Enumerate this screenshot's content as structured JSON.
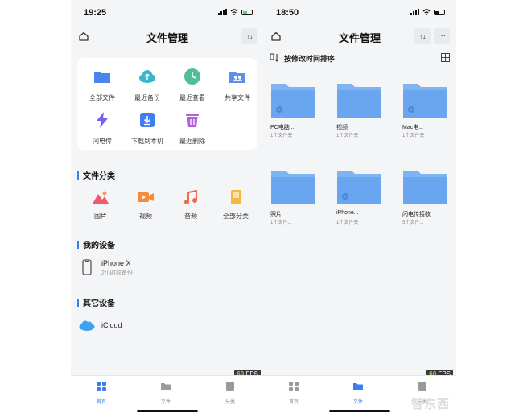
{
  "left_phone": {
    "status_time": "19:25",
    "title": "文件管理",
    "quick_actions": [
      {
        "label": "全部文件",
        "icon": "folder-icon"
      },
      {
        "label": "最近备份",
        "icon": "cloud-upload-icon"
      },
      {
        "label": "最近查看",
        "icon": "clock-icon"
      },
      {
        "label": "共享文件",
        "icon": "shared-folder-icon"
      },
      {
        "label": "闪电传",
        "icon": "lightning-icon"
      },
      {
        "label": "下载到本机",
        "icon": "download-icon"
      },
      {
        "label": "最近删除",
        "icon": "trash-icon"
      }
    ],
    "categories_title": "文件分类",
    "categories": [
      {
        "label": "图片",
        "icon": "image-icon"
      },
      {
        "label": "视频",
        "icon": "video-icon"
      },
      {
        "label": "音频",
        "icon": "music-icon"
      },
      {
        "label": "全部分类",
        "icon": "all-categories-icon"
      }
    ],
    "my_devices_title": "我的设备",
    "my_device": {
      "name": "iPhone X",
      "subtitle": "2小时前备份"
    },
    "other_devices_title": "其它设备",
    "other_device": {
      "name": "iCloud"
    },
    "tabs": [
      {
        "label": "首页",
        "active": true
      },
      {
        "label": "文件",
        "active": false
      },
      {
        "label": "分类",
        "active": false
      }
    ],
    "fps_value": "60",
    "fps_unit": "FPS"
  },
  "right_phone": {
    "status_time": "18:50",
    "title": "文件管理",
    "sort_label": "按修改时间排序",
    "folders": [
      {
        "name": "PC电脑...",
        "count": "1个文件夹"
      },
      {
        "name": "视频",
        "count": "1个文件夹"
      },
      {
        "name": "Mac电...",
        "count": "1个文件夹"
      },
      {
        "name": "照片",
        "count": "1个文件..."
      },
      {
        "name": "iPhone...",
        "count": "1个文件夹"
      },
      {
        "name": "闪电传接收",
        "count": "5个文件..."
      }
    ],
    "tabs": [
      {
        "label": "首页",
        "active": false
      },
      {
        "label": "文件",
        "active": true
      },
      {
        "label": "分类",
        "active": false
      }
    ],
    "fps_value": "60",
    "fps_unit": "FPS"
  },
  "watermark": "智东西",
  "colors": {
    "accent": "#3d7cf2",
    "folder_blue": "#6aa5f0",
    "fps_green": "#8bd35a"
  }
}
